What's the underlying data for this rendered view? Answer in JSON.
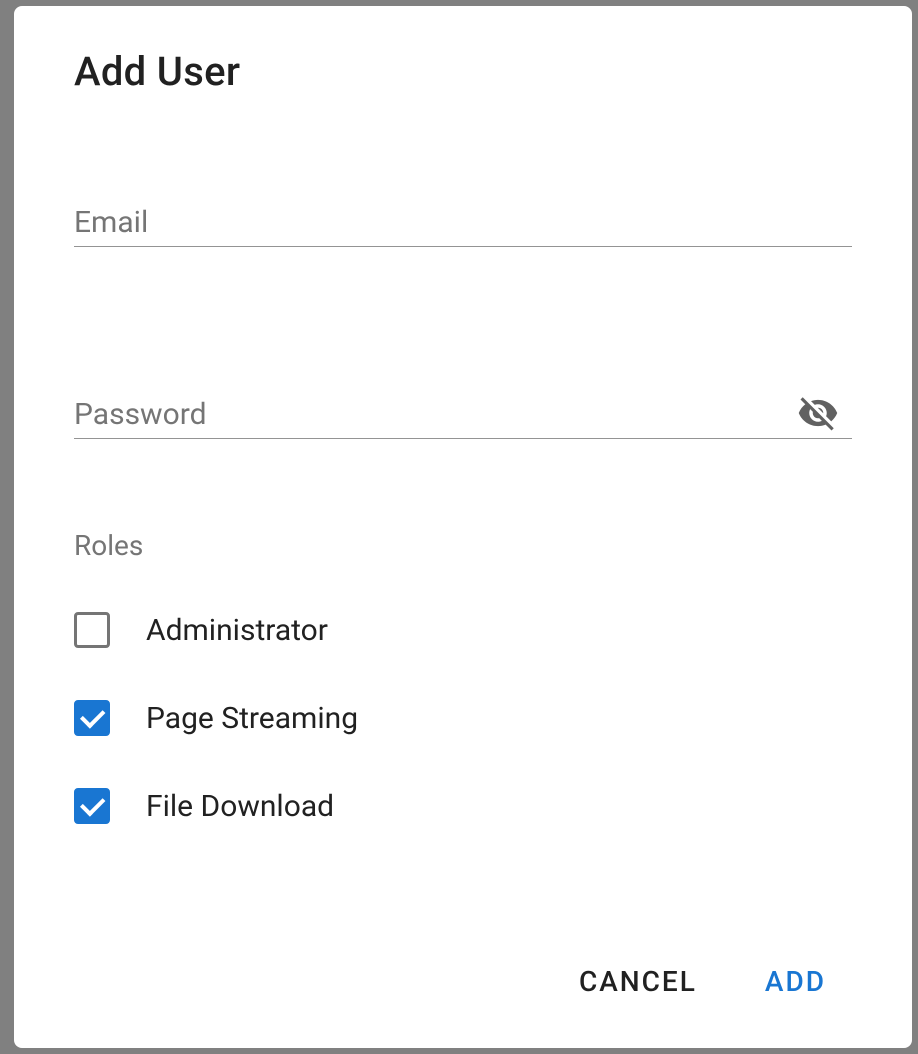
{
  "dialog": {
    "title": "Add User",
    "fields": {
      "email": {
        "label": "Email",
        "value": ""
      },
      "password": {
        "label": "Password",
        "value": ""
      }
    },
    "roles": {
      "heading": "Roles",
      "options": [
        {
          "label": "Administrator",
          "checked": false
        },
        {
          "label": "Page Streaming",
          "checked": true
        },
        {
          "label": "File Download",
          "checked": true
        }
      ]
    },
    "actions": {
      "cancel": "CANCEL",
      "add": "ADD"
    }
  }
}
